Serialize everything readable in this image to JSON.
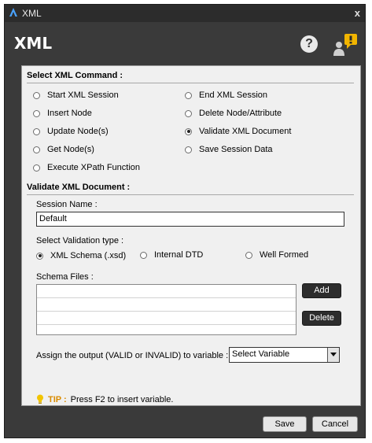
{
  "window": {
    "title": "XML"
  },
  "header": {
    "title": "XML"
  },
  "icons": {
    "help": "question-mark-icon",
    "user_alert": "user-alert-icon",
    "tip": "lightbulb-icon"
  },
  "command_section": {
    "title": "Select XML Command :",
    "selected": "Validate XML Document",
    "options_left": [
      "Start XML Session",
      "Insert Node",
      "Update Node(s)",
      "Get Node(s)",
      "Execute XPath Function"
    ],
    "options_right": [
      "End XML Session",
      "Delete Node/Attribute",
      "Validate XML Document",
      "Save Session Data"
    ]
  },
  "validate_section": {
    "title": "Validate XML Document :",
    "session_label": "Session Name :",
    "session_value": "Default",
    "validation_label": "Select Validation type :",
    "validation_options": [
      "XML Schema (.xsd)",
      "Internal DTD",
      "Well Formed"
    ],
    "validation_selected": "XML Schema (.xsd)",
    "schema_label": "Schema Files :",
    "add_label": "Add",
    "delete_label": "Delete",
    "output_label": "Assign the output (VALID or INVALID) to variable :",
    "output_value": "Select Variable"
  },
  "tip": {
    "head": "TIP :",
    "text": "Press F2 to insert variable."
  },
  "footer": {
    "save_label": "Save",
    "cancel_label": "Cancel"
  },
  "colors": {
    "titlebar": "#2c2c2c",
    "window": "#3a3a3a",
    "panel": "#f0f0f0",
    "tip": "#d98b00",
    "alert": "#f2b500"
  }
}
